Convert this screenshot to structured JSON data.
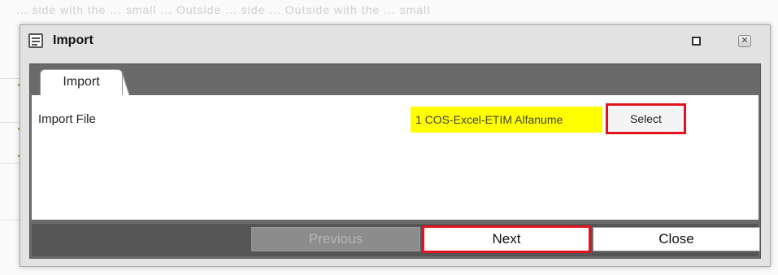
{
  "background": {
    "faded_text": "... side with the ... small ... Outside ... side ... Outside with the ... small"
  },
  "dialog": {
    "title": "Import",
    "icon": "form-icon",
    "maximize_icon": "maximize-icon",
    "close_icon": "close-icon",
    "close_glyph": "✕"
  },
  "tabs": [
    {
      "label": "Import",
      "active": true
    }
  ],
  "form": {
    "import_file_label": "Import File",
    "file_value": "1 COS-Excel-ETIM Alfanume",
    "select_label": "Select"
  },
  "footer": {
    "previous_label": "Previous",
    "previous_enabled": false,
    "next_label": "Next",
    "close_label": "Close"
  },
  "colors": {
    "highlight_yellow": "#ffff00",
    "annotation_red": "#e0141e",
    "frame_dark": "#555555"
  }
}
